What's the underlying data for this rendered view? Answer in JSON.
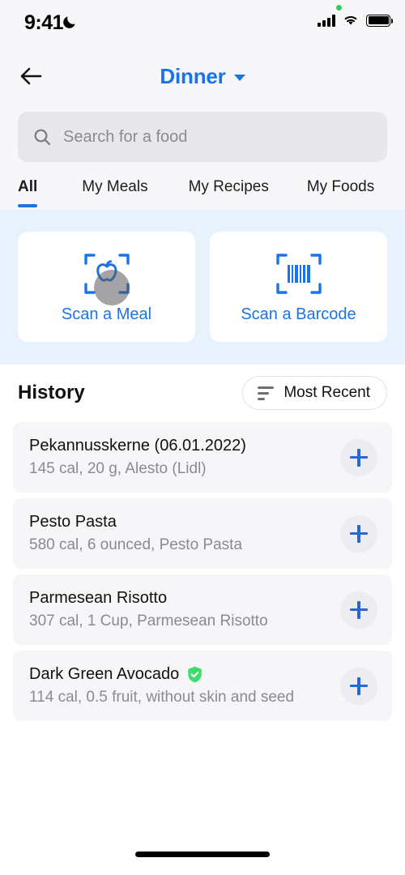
{
  "status_bar": {
    "time": "9:41",
    "dnd_icon": "moon-icon",
    "recording_dot_color": "#30d158",
    "signal_icon": "cellular-signal-icon",
    "wifi_icon": "wifi-icon",
    "battery_icon": "battery-icon"
  },
  "nav": {
    "back_icon": "back-arrow-icon",
    "title": "Dinner",
    "dropdown_icon": "chevron-down-icon",
    "title_color": "#1a73e8"
  },
  "search": {
    "icon": "search-icon",
    "placeholder": "Search for a food",
    "value": ""
  },
  "tabs": {
    "items": [
      {
        "label": "All",
        "active": true
      },
      {
        "label": "My Meals",
        "active": false
      },
      {
        "label": "My Recipes",
        "active": false
      },
      {
        "label": "My Foods",
        "active": false
      }
    ],
    "indicator_color": "#1a73e8"
  },
  "scan_section": {
    "background_color": "#e8f2fd",
    "cards": [
      {
        "label": "Scan a Meal",
        "icon": "scan-meal-apple-icon"
      },
      {
        "label": "Scan a Barcode",
        "icon": "scan-barcode-icon"
      }
    ]
  },
  "history": {
    "title": "History",
    "sort": {
      "label": "Most Recent",
      "icon": "sort-icon"
    },
    "items": [
      {
        "title": "Pekannusskerne (06.01.2022)",
        "subtitle": "145 cal, 20 g, Alesto (Lidl)",
        "verified": false,
        "add_icon": "plus-icon"
      },
      {
        "title": "Pesto Pasta",
        "subtitle": "580 cal, 6 ounced, Pesto Pasta",
        "verified": false,
        "add_icon": "plus-icon"
      },
      {
        "title": "Parmesean Risotto",
        "subtitle": "307 cal, 1 Cup, Parmesean Risotto",
        "verified": false,
        "add_icon": "plus-icon"
      },
      {
        "title": "Dark Green Avocado",
        "subtitle": "114 cal, 0.5 fruit, without skin and seed",
        "verified": true,
        "verified_color": "#3ddc6e",
        "add_icon": "plus-icon"
      }
    ]
  },
  "home_indicator": "home-indicator"
}
